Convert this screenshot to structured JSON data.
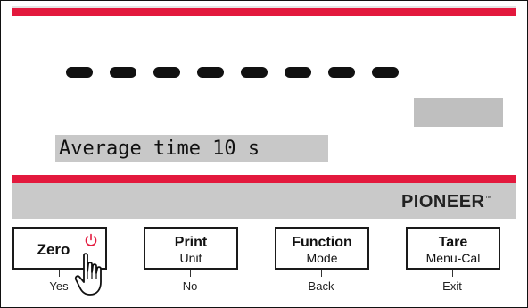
{
  "display": {
    "dash_count": 8,
    "message": "Average time 10 s",
    "brand": "PIONEER",
    "trademark": "™"
  },
  "colors": {
    "accent_red": "#e3193d",
    "panel_gray": "#c9c9c9",
    "lcd_gray": "#c8c8c8"
  },
  "keys": [
    {
      "label": "Zero",
      "sub": "",
      "alt": "Yes",
      "icon": "power-icon"
    },
    {
      "label": "Print",
      "sub": "Unit",
      "alt": "No"
    },
    {
      "label": "Function",
      "sub": "Mode",
      "alt": "Back"
    },
    {
      "label": "Tare",
      "sub": "Menu-Cal",
      "alt": "Exit"
    }
  ],
  "cursor": {
    "icon": "hand-pointer-icon"
  }
}
